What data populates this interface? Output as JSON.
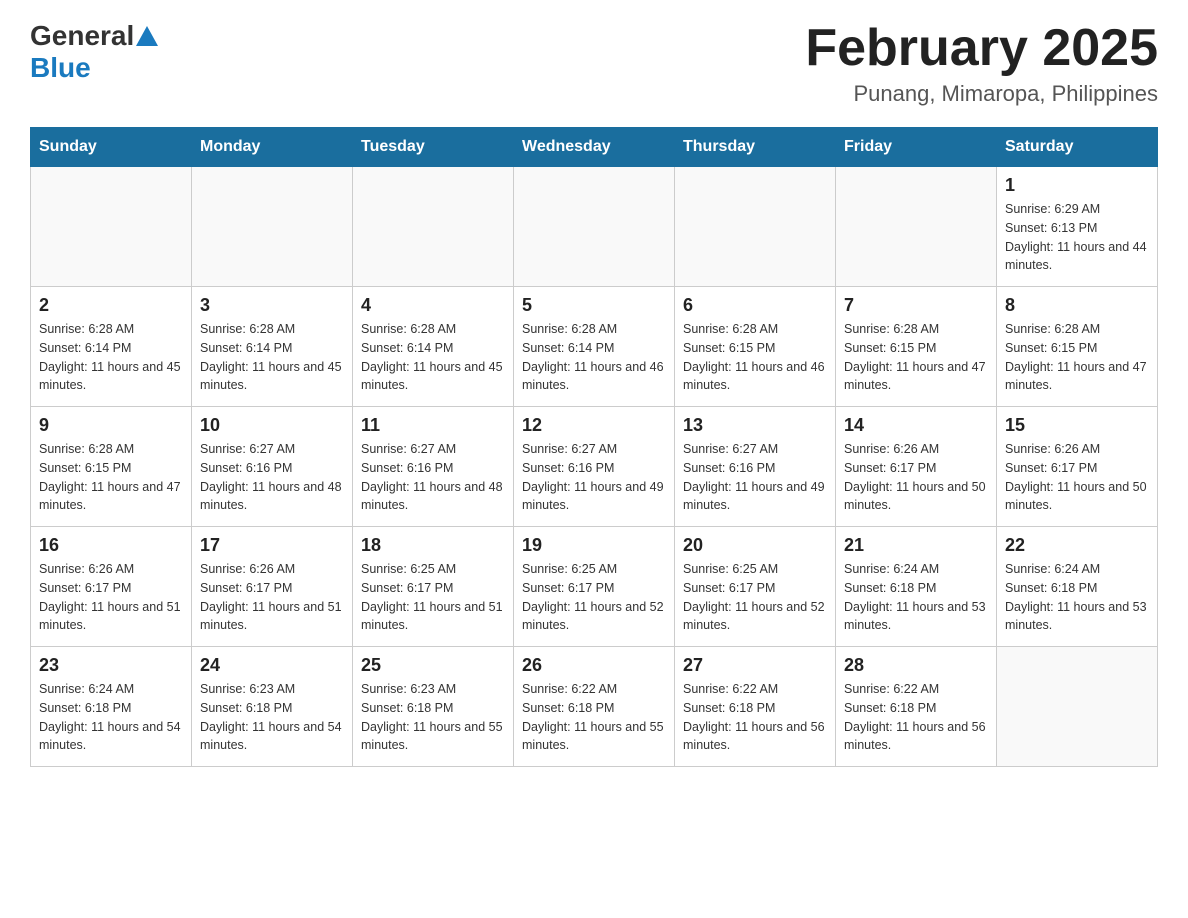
{
  "header": {
    "logo_general": "General",
    "logo_blue": "Blue",
    "month_title": "February 2025",
    "location": "Punang, Mimaropa, Philippines"
  },
  "weekdays": [
    "Sunday",
    "Monday",
    "Tuesday",
    "Wednesday",
    "Thursday",
    "Friday",
    "Saturday"
  ],
  "weeks": [
    {
      "days": [
        {
          "number": "",
          "info": ""
        },
        {
          "number": "",
          "info": ""
        },
        {
          "number": "",
          "info": ""
        },
        {
          "number": "",
          "info": ""
        },
        {
          "number": "",
          "info": ""
        },
        {
          "number": "",
          "info": ""
        },
        {
          "number": "1",
          "info": "Sunrise: 6:29 AM\nSunset: 6:13 PM\nDaylight: 11 hours and 44 minutes."
        }
      ]
    },
    {
      "days": [
        {
          "number": "2",
          "info": "Sunrise: 6:28 AM\nSunset: 6:14 PM\nDaylight: 11 hours and 45 minutes."
        },
        {
          "number": "3",
          "info": "Sunrise: 6:28 AM\nSunset: 6:14 PM\nDaylight: 11 hours and 45 minutes."
        },
        {
          "number": "4",
          "info": "Sunrise: 6:28 AM\nSunset: 6:14 PM\nDaylight: 11 hours and 45 minutes."
        },
        {
          "number": "5",
          "info": "Sunrise: 6:28 AM\nSunset: 6:14 PM\nDaylight: 11 hours and 46 minutes."
        },
        {
          "number": "6",
          "info": "Sunrise: 6:28 AM\nSunset: 6:15 PM\nDaylight: 11 hours and 46 minutes."
        },
        {
          "number": "7",
          "info": "Sunrise: 6:28 AM\nSunset: 6:15 PM\nDaylight: 11 hours and 47 minutes."
        },
        {
          "number": "8",
          "info": "Sunrise: 6:28 AM\nSunset: 6:15 PM\nDaylight: 11 hours and 47 minutes."
        }
      ]
    },
    {
      "days": [
        {
          "number": "9",
          "info": "Sunrise: 6:28 AM\nSunset: 6:15 PM\nDaylight: 11 hours and 47 minutes."
        },
        {
          "number": "10",
          "info": "Sunrise: 6:27 AM\nSunset: 6:16 PM\nDaylight: 11 hours and 48 minutes."
        },
        {
          "number": "11",
          "info": "Sunrise: 6:27 AM\nSunset: 6:16 PM\nDaylight: 11 hours and 48 minutes."
        },
        {
          "number": "12",
          "info": "Sunrise: 6:27 AM\nSunset: 6:16 PM\nDaylight: 11 hours and 49 minutes."
        },
        {
          "number": "13",
          "info": "Sunrise: 6:27 AM\nSunset: 6:16 PM\nDaylight: 11 hours and 49 minutes."
        },
        {
          "number": "14",
          "info": "Sunrise: 6:26 AM\nSunset: 6:17 PM\nDaylight: 11 hours and 50 minutes."
        },
        {
          "number": "15",
          "info": "Sunrise: 6:26 AM\nSunset: 6:17 PM\nDaylight: 11 hours and 50 minutes."
        }
      ]
    },
    {
      "days": [
        {
          "number": "16",
          "info": "Sunrise: 6:26 AM\nSunset: 6:17 PM\nDaylight: 11 hours and 51 minutes."
        },
        {
          "number": "17",
          "info": "Sunrise: 6:26 AM\nSunset: 6:17 PM\nDaylight: 11 hours and 51 minutes."
        },
        {
          "number": "18",
          "info": "Sunrise: 6:25 AM\nSunset: 6:17 PM\nDaylight: 11 hours and 51 minutes."
        },
        {
          "number": "19",
          "info": "Sunrise: 6:25 AM\nSunset: 6:17 PM\nDaylight: 11 hours and 52 minutes."
        },
        {
          "number": "20",
          "info": "Sunrise: 6:25 AM\nSunset: 6:17 PM\nDaylight: 11 hours and 52 minutes."
        },
        {
          "number": "21",
          "info": "Sunrise: 6:24 AM\nSunset: 6:18 PM\nDaylight: 11 hours and 53 minutes."
        },
        {
          "number": "22",
          "info": "Sunrise: 6:24 AM\nSunset: 6:18 PM\nDaylight: 11 hours and 53 minutes."
        }
      ]
    },
    {
      "days": [
        {
          "number": "23",
          "info": "Sunrise: 6:24 AM\nSunset: 6:18 PM\nDaylight: 11 hours and 54 minutes."
        },
        {
          "number": "24",
          "info": "Sunrise: 6:23 AM\nSunset: 6:18 PM\nDaylight: 11 hours and 54 minutes."
        },
        {
          "number": "25",
          "info": "Sunrise: 6:23 AM\nSunset: 6:18 PM\nDaylight: 11 hours and 55 minutes."
        },
        {
          "number": "26",
          "info": "Sunrise: 6:22 AM\nSunset: 6:18 PM\nDaylight: 11 hours and 55 minutes."
        },
        {
          "number": "27",
          "info": "Sunrise: 6:22 AM\nSunset: 6:18 PM\nDaylight: 11 hours and 56 minutes."
        },
        {
          "number": "28",
          "info": "Sunrise: 6:22 AM\nSunset: 6:18 PM\nDaylight: 11 hours and 56 minutes."
        },
        {
          "number": "",
          "info": ""
        }
      ]
    }
  ]
}
